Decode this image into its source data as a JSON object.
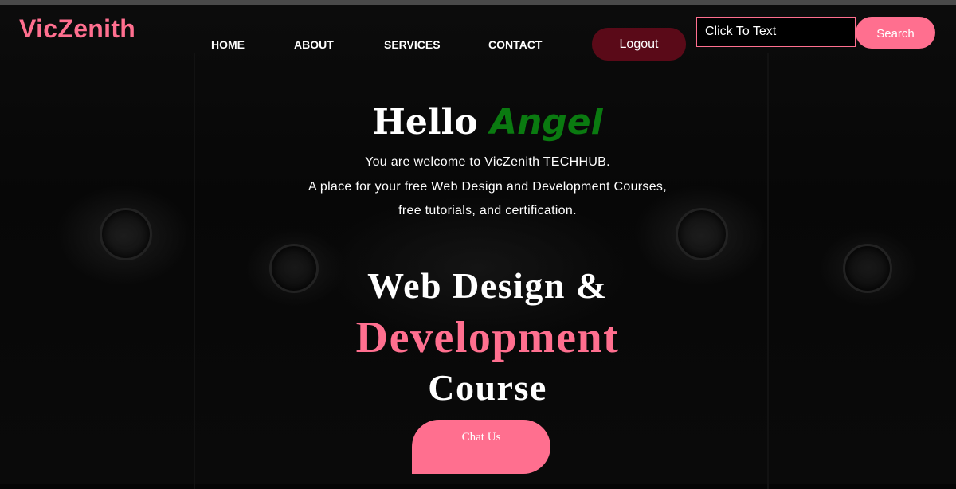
{
  "brand": {
    "logo_text": "VicZenith"
  },
  "nav": {
    "items": [
      {
        "label": "HOME"
      },
      {
        "label": "ABOUT"
      },
      {
        "label": "SERVICES"
      },
      {
        "label": "CONTACT"
      }
    ]
  },
  "header": {
    "logout_label": "Logout",
    "search_placeholder": "Click To Text",
    "search_button_label": "Search"
  },
  "hero": {
    "greeting": "Hello",
    "user_name": "Angel",
    "intro_lines": [
      "You are welcome to VicZenith TECHHUB.",
      "A place for your free Web Design and Development Courses,",
      "free tutorials, and certification."
    ],
    "headline_line1": "Web Design &",
    "headline_line2": "Development",
    "headline_line3": "Course",
    "cta_label": "Chat Us"
  },
  "colors": {
    "accent_pink": "#ff6f8f",
    "logout_bg": "#5a0a18",
    "name_green": "#0a7a10",
    "background": "#050505"
  }
}
